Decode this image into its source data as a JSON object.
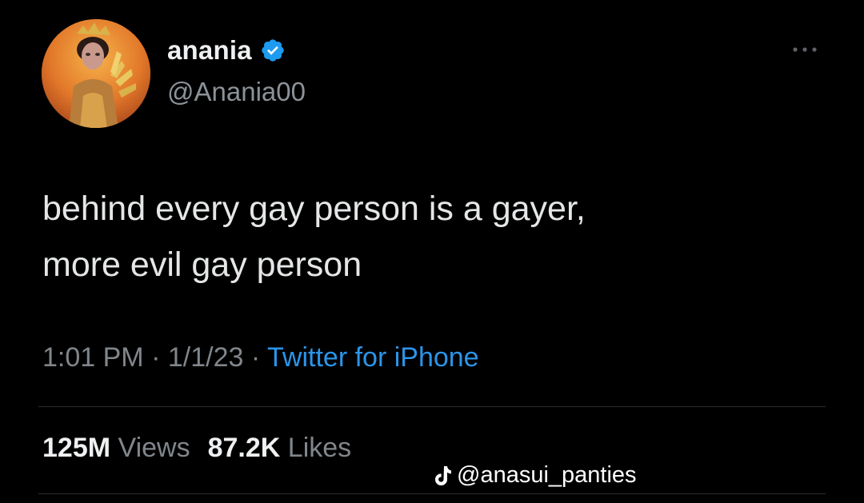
{
  "tweet": {
    "author": {
      "display_name": "anania",
      "handle": "@Anania00",
      "verified": true,
      "avatar": "profile-photo-gold-costume"
    },
    "text_lines": [
      "behind every gay person is a gayer,",
      "more evil gay person"
    ],
    "meta": {
      "time": "1:01 PM",
      "separator": "·",
      "date": "1/1/23",
      "source": "Twitter for iPhone"
    },
    "stats": {
      "views_count": "125M",
      "views_label": "Views",
      "likes_count": "87.2K",
      "likes_label": "Likes"
    },
    "more_icon": "more-options-icon"
  },
  "watermark": {
    "icon": "tiktok-icon",
    "text": "@anasui_panties"
  },
  "colors": {
    "background": "#000000",
    "primary_text": "#e7e9ea",
    "secondary_text": "#80868b",
    "link_blue": "#2b95e9",
    "verified_blue": "#1d9bf0"
  }
}
